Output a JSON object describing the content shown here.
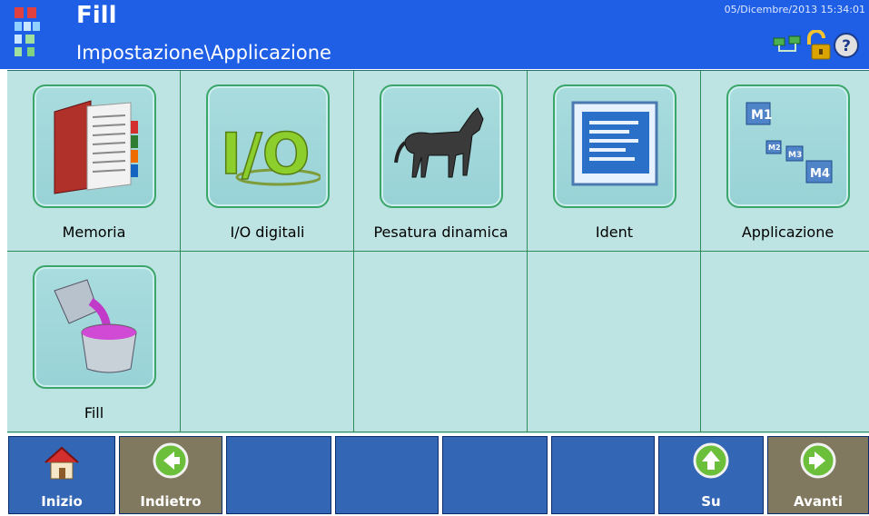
{
  "header": {
    "title": "Fill",
    "path": "Impostazione\\Applicazione",
    "datetime": "05/Dicembre/2013 15:34:01",
    "icons": [
      "app-logo-icon",
      "network-icon",
      "lock-open-icon",
      "help-icon"
    ]
  },
  "grid": {
    "items": [
      {
        "label": "Memoria",
        "icon": "memory-book-icon"
      },
      {
        "label": "I/O digitali",
        "icon": "io-icon"
      },
      {
        "label": "Pesatura dinamica",
        "icon": "horse-icon"
      },
      {
        "label": "Ident",
        "icon": "ident-window-icon"
      },
      {
        "label": "Applicazione",
        "icon": "memory-slots-icon"
      },
      {
        "label": "Fill",
        "icon": "bucket-fill-icon"
      }
    ]
  },
  "footer": {
    "buttons": [
      {
        "label": "Inizio",
        "icon": "home-icon"
      },
      {
        "label": "Indietro",
        "icon": "arrow-left-icon"
      },
      {
        "label": "",
        "icon": ""
      },
      {
        "label": "",
        "icon": ""
      },
      {
        "label": "",
        "icon": ""
      },
      {
        "label": "",
        "icon": ""
      },
      {
        "label": "Su",
        "icon": "arrow-up-icon"
      },
      {
        "label": "Avanti",
        "icon": "arrow-right-icon"
      }
    ]
  },
  "colors": {
    "header_bg": "#1f5fe6",
    "grid_bg": "#bde3e3",
    "footer_blue": "#3366b4",
    "footer_khaki": "#807960"
  }
}
